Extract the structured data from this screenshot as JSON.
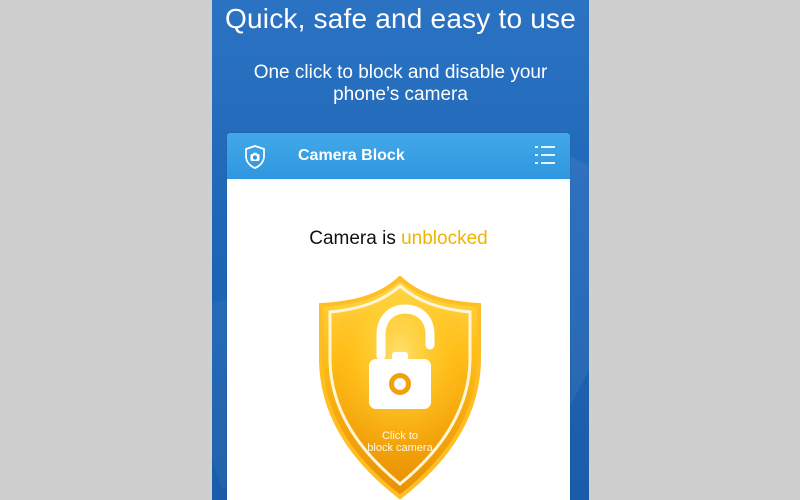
{
  "headline": "Quick, safe and easy to use",
  "subtitle": "One click to block and disable your phone’s camera",
  "app": {
    "title": "Camera Block",
    "icon": "shield-camera-icon",
    "menu_icon": "menu-icon"
  },
  "status": {
    "prefix": "Camera is ",
    "state": "unblocked"
  },
  "action": {
    "line1": "Click to",
    "line2": "block camera",
    "icon": "unlocked-camera-shield-icon"
  },
  "colors": {
    "outer_background": "#cfcfcf",
    "phone_background": "#1f66b8",
    "header_blue": "#2f97df",
    "highlight_yellow": "#efb400",
    "shield_orange": "#f4a90a"
  }
}
